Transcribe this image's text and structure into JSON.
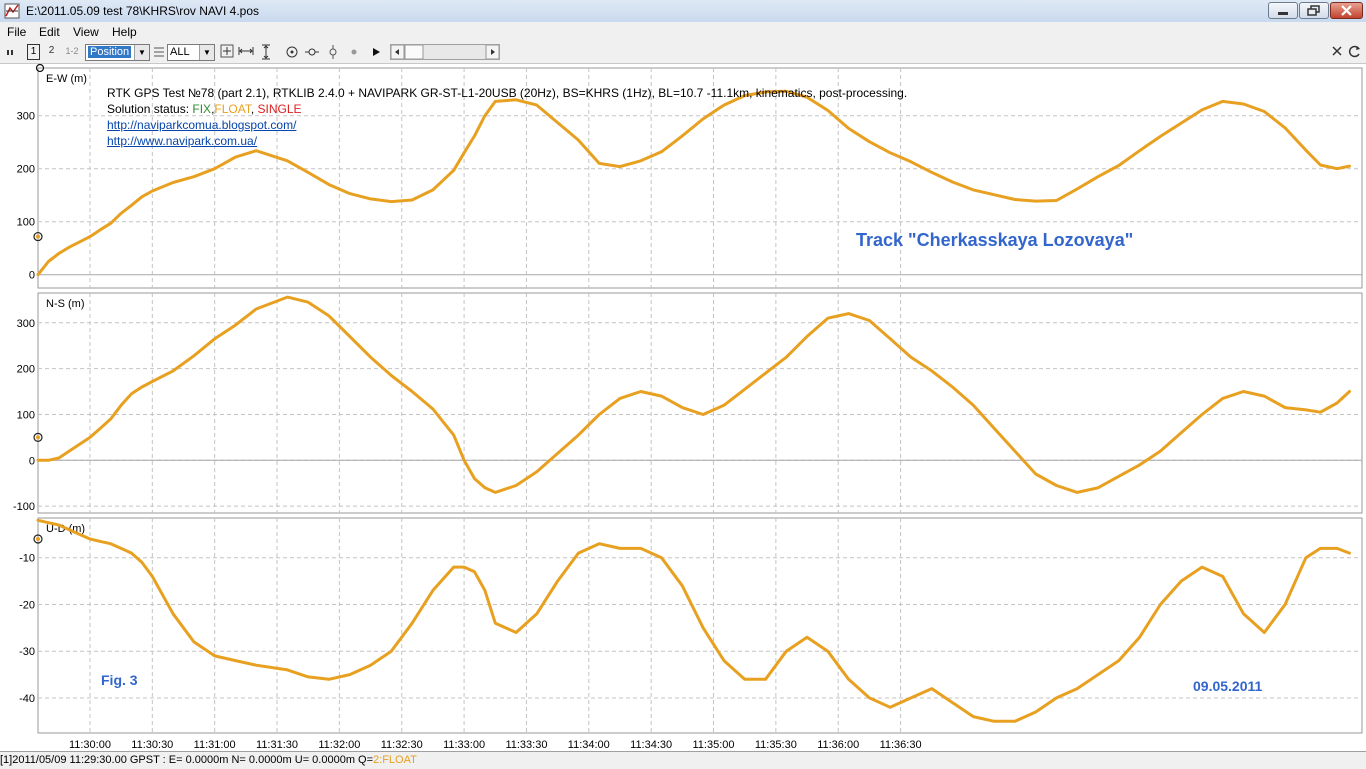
{
  "window": {
    "title": "E:\\2011.05.09 test 78\\KHRS\\rov NAVI 4.pos"
  },
  "menu": [
    "File",
    "Edit",
    "View",
    "Help"
  ],
  "toolbar": {
    "btn1": "1",
    "btn2": "2",
    "btn12": "1-2",
    "plot_type": "Position",
    "quality_filter": "ALL"
  },
  "annotations": {
    "header_line": "RTK GPS Test №78 (part 2.1), RTKLIB 2.4.0 + NAVIPARK GR-ST-L1-20USB (20Hz), BS=KHRS (1Hz), BL=10.7 -11.1km, kinematics, post-processing.",
    "status_prefix": "Solution status: ",
    "status_fix": "FIX",
    "status_float": "FLOAT",
    "status_single": "SINGLE",
    "link1": "http://naviparkcomua.blogspot.com/",
    "link2": "http://www.navipark.com.ua/",
    "track_title": "Track \"Cherkasskaya Lozovaya\"",
    "fig_label": "Fig. 3",
    "date_label": "09.05.2011"
  },
  "colors": {
    "track": "#e8a020",
    "fix": "#2e8b2e",
    "float": "#e8a020",
    "single": "#e02020",
    "annotation_blue": "#3366cc"
  },
  "statusbar": {
    "text": "[1]2011/05/09 11:29:30.00 GPST : E= 0.0000m N= 0.0000m U= 0.0000m Q=",
    "quality": "2:FLOAT"
  },
  "chart_data": [
    {
      "type": "line",
      "ylabel": "E-W (m)",
      "yticks": [
        100,
        200,
        300
      ],
      "ylim": [
        -25,
        390
      ],
      "x_ticks": [
        "11:30:00",
        "11:30:30",
        "11:31:00",
        "11:31:30",
        "11:32:00",
        "11:32:30",
        "11:33:00",
        "11:33:30",
        "11:34:00",
        "11:34:30",
        "11:35:00",
        "11:35:30",
        "11:36:00",
        "11:36:30"
      ],
      "x_seconds": [
        -25,
        -20,
        -15,
        -10,
        -5,
        0,
        5,
        10,
        15,
        20,
        25,
        30,
        40,
        50,
        60,
        70,
        80,
        95,
        105,
        115,
        125,
        135,
        145,
        155,
        165,
        175,
        180,
        185,
        190,
        195,
        205,
        215,
        225,
        235,
        245,
        255,
        265,
        275,
        285,
        295,
        305,
        315,
        325,
        335,
        345,
        355,
        365,
        375,
        385,
        395,
        405,
        415,
        425,
        435,
        445,
        455,
        465,
        475,
        485,
        495,
        505,
        515,
        525,
        535,
        545,
        555,
        565,
        575,
        585,
        592,
        600,
        606,
        612
      ],
      "values": [
        0,
        25,
        40,
        52,
        62,
        72,
        85,
        97,
        116,
        131,
        147,
        158,
        174,
        185,
        200,
        222,
        234,
        215,
        193,
        170,
        153,
        143,
        138,
        141,
        160,
        197,
        230,
        262,
        300,
        327,
        330,
        320,
        287,
        254,
        210,
        204,
        215,
        232,
        262,
        294,
        320,
        338,
        345,
        346,
        335,
        310,
        276,
        251,
        230,
        213,
        193,
        175,
        160,
        151,
        142,
        139,
        140,
        162,
        185,
        206,
        234,
        261,
        286,
        311,
        327,
        322,
        308,
        277,
        235,
        207,
        200,
        205
      ]
    },
    {
      "type": "line",
      "ylabel": "N-S (m)",
      "yticks": [
        -100,
        0,
        100,
        200,
        300
      ],
      "ylim": [
        -115,
        365
      ],
      "values": [
        0,
        0,
        5,
        20,
        35,
        50,
        70,
        90,
        120,
        145,
        160,
        172,
        195,
        228,
        265,
        295,
        330,
        356,
        345,
        315,
        270,
        225,
        185,
        150,
        112,
        55,
        0,
        -40,
        -60,
        -70,
        -55,
        -25,
        15,
        55,
        100,
        135,
        150,
        140,
        115,
        100,
        120,
        155,
        190,
        225,
        270,
        310,
        320,
        305,
        265,
        225,
        195,
        160,
        120,
        70,
        20,
        -30,
        -55,
        -70,
        -60,
        -35,
        -10,
        20,
        60,
        100,
        135,
        150,
        140,
        115,
        110,
        105,
        125,
        150
      ]
    },
    {
      "type": "line",
      "ylabel": "U-D (m)",
      "yticks": [
        -40,
        -30,
        -20,
        -10
      ],
      "ylim": [
        -47.5,
        -1.5
      ],
      "values": [
        -2,
        -2.5,
        -3,
        -4,
        -5,
        -6,
        -6.5,
        -7,
        -8,
        -9,
        -11,
        -14,
        -22,
        -28,
        -31,
        -32,
        -33,
        -34,
        -35.5,
        -36,
        -35,
        -33,
        -30,
        -24,
        -17,
        -12,
        -12,
        -13,
        -17,
        -24,
        -26,
        -22,
        -15,
        -9,
        -7,
        -8,
        -8,
        -10,
        -16,
        -25,
        -32,
        -36,
        -36,
        -30,
        -27,
        -30,
        -36,
        -40,
        -42,
        -40,
        -38,
        -41,
        -44,
        -45,
        -45,
        -43,
        -40,
        -38,
        -35,
        -32,
        -27,
        -20,
        -15,
        -12,
        -14,
        -22,
        -26,
        -20,
        -10,
        -8,
        -8,
        -9
      ]
    }
  ]
}
